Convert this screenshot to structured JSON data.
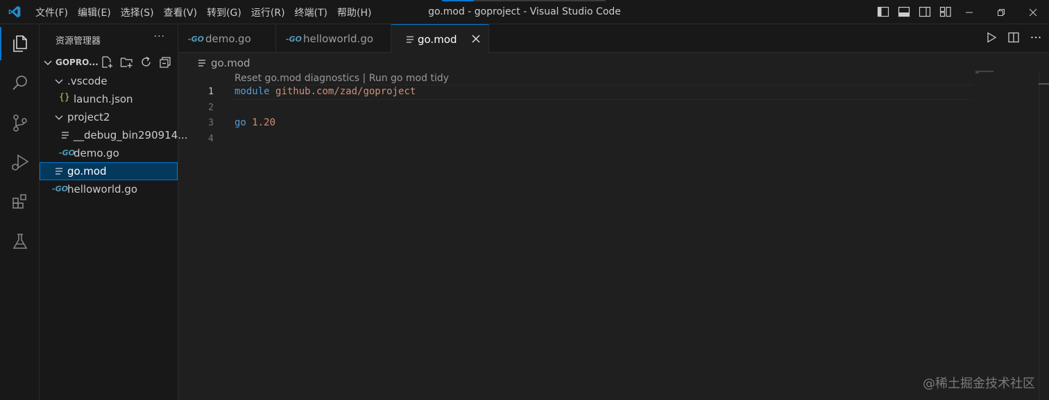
{
  "menu": [
    "文件(F)",
    "编辑(E)",
    "选择(S)",
    "查看(V)",
    "转到(G)",
    "运行(R)",
    "终端(T)",
    "帮助(H)"
  ],
  "window_title": "go.mod - goproject - Visual Studio Code",
  "colors": {
    "accent": "#0078d4",
    "go_blue": "#519aba",
    "json_yellow": "#cbcb41",
    "keyword": "#569cd6",
    "string": "#ce9178"
  },
  "activity_bar": [
    "explorer-icon",
    "search-icon",
    "source-control-icon",
    "run-debug-icon",
    "extensions-icon",
    "testing-icon"
  ],
  "sidebar": {
    "title": "资源管理器",
    "more": "···",
    "section": "GOPRO...",
    "tree": [
      {
        "label": ".vscode",
        "type": "folder"
      },
      {
        "label": "launch.json",
        "type": "json",
        "icon_text": "{}"
      },
      {
        "label": "project2",
        "type": "folder"
      },
      {
        "label": "__debug_bin290914...",
        "type": "file"
      },
      {
        "label": "demo.go",
        "type": "go"
      },
      {
        "label": "go.mod",
        "type": "file",
        "selected": true
      },
      {
        "label": "helloworld.go",
        "type": "go"
      }
    ]
  },
  "tabs": [
    {
      "label": "demo.go",
      "active": false
    },
    {
      "label": "helloworld.go",
      "active": false
    },
    {
      "label": "go.mod",
      "active": true
    }
  ],
  "breadcrumb": "go.mod",
  "editor": {
    "codelens": "Reset go.mod diagnostics | Run go mod tidy",
    "line_numbers": [
      "1",
      "2",
      "3",
      "4"
    ],
    "line1_kw": "module",
    "line1_path": "github.com/zad/goproject",
    "line3_kw": "go",
    "line3_ver": "1.20"
  },
  "watermark": "@稀土掘金技术社区"
}
